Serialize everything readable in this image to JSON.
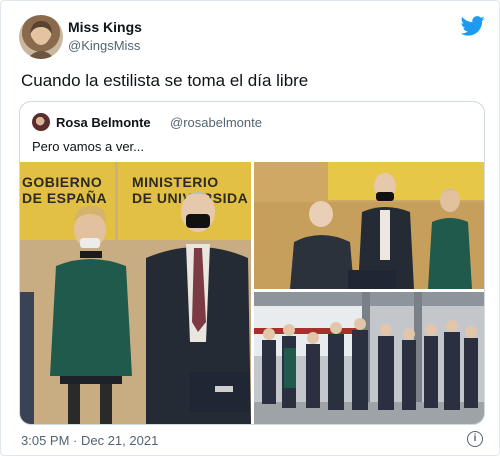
{
  "tweet": {
    "display_name": "Miss Kings",
    "handle": "@KingsMiss",
    "text": "Cuando la estilista se toma el día libre",
    "timestamp": "3:05 PM · Dec 21, 2021"
  },
  "quoted_tweet": {
    "display_name": "Rosa Belmonte",
    "handle": "@rosabelmonte",
    "text": "Pero vamos a ver..."
  },
  "photo_text": {
    "banner_left": "GOBIERNO\nDE ESPAÑA",
    "banner_right": "MINISTERIO\nDE UNIVERSIDA"
  },
  "icons": {
    "brand": "twitter-bird-icon",
    "info": "info-icon"
  },
  "colors": {
    "brand_blue": "#1d9bf0",
    "secondary_text": "#536471",
    "border": "#cfd9de"
  }
}
